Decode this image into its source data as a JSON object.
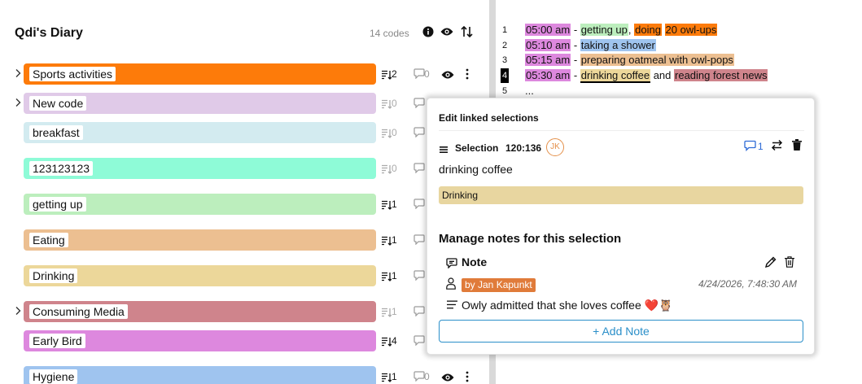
{
  "project": {
    "title": "Qdi's Diary",
    "codes_count": "14 codes"
  },
  "icons": {
    "info": "info-icon",
    "eye": "eye-icon",
    "sort": "sort-icon",
    "chevron": "chevron-right-icon",
    "comment": "comment-icon",
    "more": "more-vertical-icon"
  },
  "codes": [
    {
      "label": "Sports activities",
      "color": "#fd7b0a",
      "count": "2",
      "comments": "0",
      "chevron": true,
      "active": true,
      "eye": true,
      "more": true
    },
    {
      "label": "New code",
      "color": "#e0cae8",
      "count": "0",
      "comments": "",
      "chevron": true,
      "active": false,
      "eye": false,
      "more": false
    },
    {
      "label": "breakfast",
      "color": "#d3ebf0",
      "count": "0",
      "comments": "",
      "chevron": false,
      "active": false,
      "eye": false,
      "more": false
    },
    {
      "label": "123123123",
      "color": "#8efbd7",
      "count": "0",
      "comments": "",
      "chevron": false,
      "active": false,
      "eye": false,
      "more": false
    },
    {
      "label": "getting up",
      "color": "#bceebd",
      "count": "1",
      "comments": "",
      "chevron": false,
      "active": true,
      "eye": false,
      "more": false
    },
    {
      "label": "Eating",
      "color": "#ecbf91",
      "count": "1",
      "comments": "",
      "chevron": false,
      "active": true,
      "eye": false,
      "more": false
    },
    {
      "label": "Drinking",
      "color": "#ecd79a",
      "count": "1",
      "comments": "",
      "chevron": false,
      "active": true,
      "eye": false,
      "more": false
    },
    {
      "label": "Consuming Media",
      "color": "#cf848c",
      "count": "1",
      "comments": "",
      "chevron": true,
      "active": false,
      "eye": false,
      "more": false
    },
    {
      "label": "Early Bird",
      "color": "#dd88de",
      "count": "4",
      "comments": "",
      "chevron": false,
      "active": true,
      "eye": false,
      "more": false
    },
    {
      "label": "Hygiene",
      "color": "#9fc4ef",
      "count": "1",
      "comments": "0",
      "chevron": false,
      "active": true,
      "eye": true,
      "more": true
    }
  ],
  "document": {
    "lines": [
      {
        "num": "1",
        "active": false,
        "segments": [
          {
            "text": "05:00 am",
            "bg": "#dd88de"
          },
          {
            "text": " - ",
            "bg": ""
          },
          {
            "text": "getting up",
            "bg": "#bceebd"
          },
          {
            "text": ", ",
            "bg": ""
          },
          {
            "text": "doing",
            "bg": "#fd7b0a"
          },
          {
            "text": " ",
            "bg": ""
          },
          {
            "text": "20 owl-ups",
            "bg": "#fd7b0a"
          }
        ]
      },
      {
        "num": "2",
        "active": false,
        "segments": [
          {
            "text": "05:10 am",
            "bg": "#dd88de"
          },
          {
            "text": " - ",
            "bg": ""
          },
          {
            "text": "taking a shower",
            "bg": "#9fc4ef"
          }
        ]
      },
      {
        "num": "3",
        "active": false,
        "segments": [
          {
            "text": "05:15 am",
            "bg": "#dd88de"
          },
          {
            "text": " - ",
            "bg": ""
          },
          {
            "text": "preparing oatmeal with owl-pops",
            "bg": "#ecbf91"
          }
        ]
      },
      {
        "num": "4",
        "active": true,
        "segments": [
          {
            "text": "05:30 am",
            "bg": "#dd88de"
          },
          {
            "text": " - ",
            "bg": ""
          },
          {
            "text": "drinking coffee",
            "bg": "#ecd79a",
            "underline": true
          },
          {
            "text": " and ",
            "bg": ""
          },
          {
            "text": "reading forest news",
            "bg": "#cf848c"
          }
        ]
      },
      {
        "num": "5",
        "active": false,
        "segments": [
          {
            "text": "...",
            "bg": ""
          }
        ]
      }
    ]
  },
  "popover": {
    "title": "Edit linked selections",
    "selection_label": "Selection",
    "selection_range": "120:136",
    "avatar_initials": "JK",
    "comment_count": "1",
    "selected_text": "drinking coffee",
    "code_tag": "Drinking",
    "code_tag_color": "#e8d6a0",
    "notes_title": "Manage notes for this selection",
    "note_label": "Note",
    "author": "by Jan Kapunkt",
    "date": "4/24/2026, 7:48:30 AM",
    "note_text": "Owly admitted that she loves coffee ❤️🦉",
    "add_note": "+ Add Note",
    "accent_color": "#2b8fc9",
    "author_color": "#e07b3a"
  }
}
